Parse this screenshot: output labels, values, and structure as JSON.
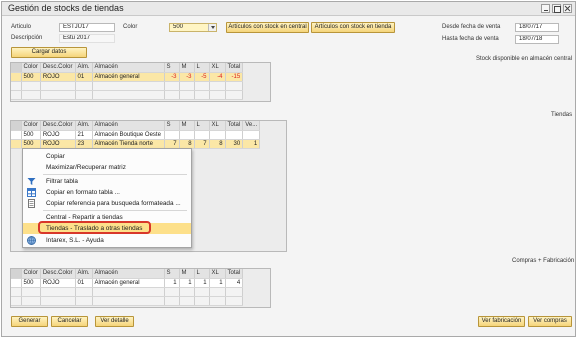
{
  "window": {
    "title": "Gestión de stocks de tiendas"
  },
  "filters": {
    "articulo_label": "Articulo",
    "articulo_value": "ESTJU17",
    "color_label": "Color",
    "color_value": "500",
    "descripcion_label": "Descripción",
    "descripcion_value": "Estu 2017",
    "desde_label": "Desde fecha de venta",
    "desde_value": "18/07/17",
    "hasta_label": "Hasta fecha de venta",
    "hasta_value": "18/07/18"
  },
  "buttons": {
    "stock_central": "Artículos con stock en central",
    "stock_tienda": "Artículos con stock en tienda",
    "cargar": "Cargar datos",
    "generar": "Generar",
    "cancelar": "Cancelar",
    "ver_detalle": "Ver detalle",
    "ver_fabricacion": "Ver fabricación",
    "ver_compras": "Ver compras"
  },
  "sections": {
    "central": "Stock disponible en almacén central",
    "tiendas": "Tiendas",
    "compras": "Compras + Fabricación"
  },
  "grid_central": {
    "headers": [
      "Color",
      "Desc.Color",
      "Alm.",
      "Almacén",
      "S",
      "M",
      "L",
      "XL",
      "Total"
    ],
    "rows": [
      [
        "500",
        "ROJO",
        "01",
        "Almacén general",
        "-3",
        "-3",
        "-5",
        "-4",
        "-15"
      ]
    ]
  },
  "grid_tiendas": {
    "headers": [
      "Color",
      "Desc.Color",
      "Alm.",
      "Almacén",
      "S",
      "M",
      "L",
      "XL",
      "Total",
      "Ve..."
    ],
    "rows": [
      [
        "500",
        "ROJO",
        "21",
        "Almacén Boutique Oeste",
        "",
        "",
        "",
        "",
        "",
        ""
      ],
      [
        "500",
        "ROJO",
        "23",
        "Almacén Tienda norte",
        "7",
        "8",
        "7",
        "8",
        "30",
        "1"
      ]
    ]
  },
  "grid_compras": {
    "headers": [
      "Color",
      "Desc.Color",
      "Alm.",
      "Almacén",
      "S",
      "M",
      "L",
      "XL",
      "Total"
    ],
    "rows": [
      [
        "500",
        "ROJO",
        "01",
        "Almacén general",
        "1",
        "1",
        "1",
        "1",
        "4"
      ]
    ]
  },
  "context_menu": {
    "items": [
      {
        "label": "Copiar",
        "icon": "none"
      },
      {
        "label": "Maximizar/Recuperar matriz",
        "icon": "none"
      },
      {
        "label": "Filtrar tabla",
        "icon": "filter-icon"
      },
      {
        "label": "Copiar en formato tabla ...",
        "icon": "table-icon"
      },
      {
        "label": "Copiar referencia para busqueda formateada ...",
        "icon": "document-icon"
      },
      {
        "label": "Central - Repartir a tiendas",
        "icon": "none"
      },
      {
        "label": "Tiendas - Traslado a otras tiendas",
        "icon": "none"
      },
      {
        "label": "Intarex, S.L. - Ayuda",
        "icon": "help-globe-icon"
      }
    ]
  },
  "colors": {
    "accent": "#f5d47a",
    "highlight": "#fde08a",
    "negative": "#dd2222",
    "ring": "#d8372a"
  }
}
